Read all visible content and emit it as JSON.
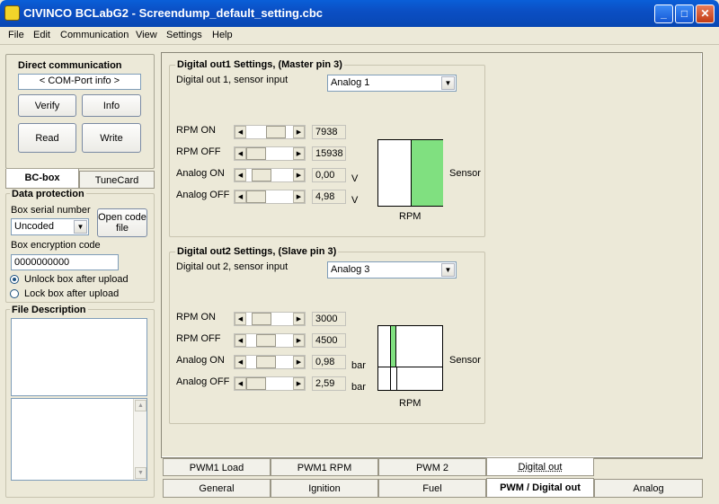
{
  "window": {
    "title": "CIVINCO  BCLabG2 - Screendump_default_setting.cbc",
    "minimize": "_",
    "maximize": "□",
    "close": "✕"
  },
  "menu": [
    "File",
    "Edit",
    "Communication",
    "View",
    "Settings",
    "Help"
  ],
  "direct": {
    "title": "Direct communication",
    "com_info": "< COM-Port info >",
    "verify": "Verify",
    "info": "Info",
    "read": "Read",
    "write": "Write"
  },
  "left_tabs": [
    "BC-box",
    "TuneCard"
  ],
  "protection": {
    "title": "Data protection",
    "serial_label": "Box serial number",
    "serial_value": "Uncoded",
    "open_code": "Open code file",
    "encryption_label": "Box encryption code",
    "encryption_value": "0000000000",
    "unlock": "Unlock box after upload",
    "lock": "Lock box after upload",
    "selected": "unlock"
  },
  "file_desc": {
    "title": "File Description"
  },
  "dout1": {
    "title": "Digital out1 Settings, (Master pin 3)",
    "sensor_label": "Digital out 1, sensor input",
    "sensor_value": "Analog 1",
    "rows": [
      {
        "label": "RPM ON",
        "value": "7938",
        "unit": "",
        "pos": 0.5
      },
      {
        "label": "RPM OFF",
        "value": "15938",
        "unit": "",
        "pos": 0.0
      },
      {
        "label": "Analog ON",
        "value": "0,00",
        "unit": "V",
        "pos": 0.15
      },
      {
        "label": "Analog OFF",
        "value": "4,98",
        "unit": "V",
        "pos": 0.0
      }
    ],
    "graph": {
      "xlabel": "RPM",
      "ylabel": "Sensor"
    }
  },
  "dout2": {
    "title": "Digital out2 Settings, (Slave pin 3)",
    "sensor_label": "Digital out 2, sensor input",
    "sensor_value": "Analog 3",
    "rows": [
      {
        "label": "RPM ON",
        "value": "3000",
        "unit": "",
        "pos": 0.15
      },
      {
        "label": "RPM OFF",
        "value": "4500",
        "unit": "",
        "pos": 0.25
      },
      {
        "label": "Analog ON",
        "value": "0,98",
        "unit": "bar",
        "pos": 0.25
      },
      {
        "label": "Analog OFF",
        "value": "2,59",
        "unit": "bar",
        "pos": 0.0
      }
    ],
    "graph": {
      "xlabel": "RPM",
      "ylabel": "Sensor"
    }
  },
  "tabs_row1": [
    "PWM1 Load",
    "PWM1 RPM",
    "PWM 2",
    "Digital out"
  ],
  "tabs_row2": [
    "General",
    "Ignition",
    "Fuel",
    "PWM / Digital out",
    "Analog"
  ],
  "colors": {
    "graph_fill": "#80e080",
    "title_blue": "#0a5fd8"
  }
}
